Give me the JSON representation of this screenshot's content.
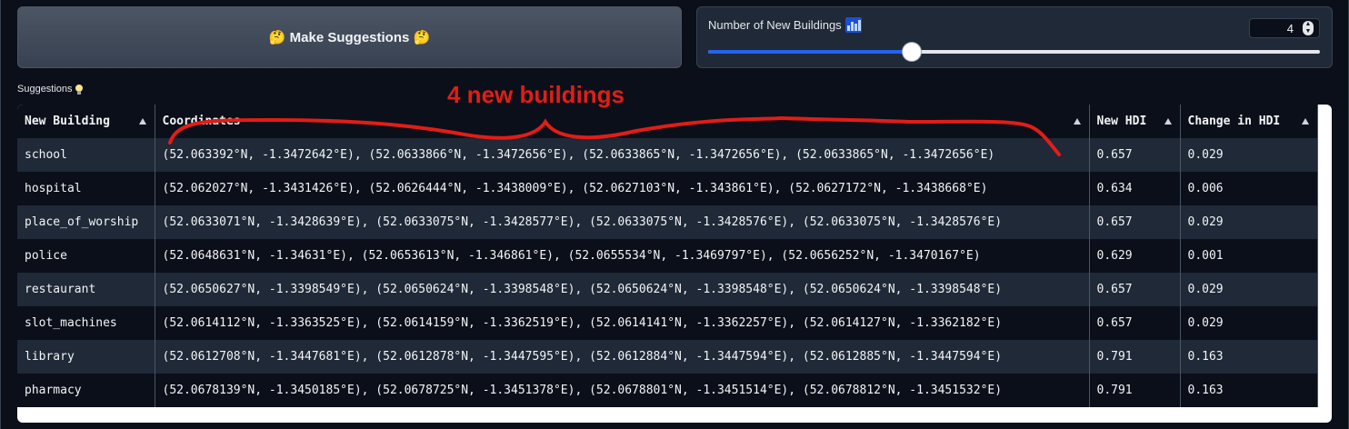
{
  "suggest_button": {
    "label": "🤔 Make Suggestions 🤔"
  },
  "slider": {
    "label": "Number of New Buildings",
    "icon": "bar-chart-icon",
    "value": "4",
    "fill_fraction": 0.333
  },
  "suggestions": {
    "label": "Suggestions",
    "icon": "lightbulb-icon",
    "columns": [
      "New Building",
      "Coordinates",
      "New HDI",
      "Change in HDI"
    ],
    "rows": [
      [
        "school",
        "(52.063392°N, -1.3472642°E), (52.0633866°N, -1.3472656°E), (52.0633865°N, -1.3472656°E), (52.0633865°N, -1.3472656°E)",
        "0.657",
        "0.029"
      ],
      [
        "hospital",
        "(52.062027°N, -1.3431426°E), (52.0626444°N, -1.3438009°E), (52.0627103°N, -1.343861°E), (52.0627172°N, -1.3438668°E)",
        "0.634",
        "0.006"
      ],
      [
        "place_of_worship",
        "(52.0633071°N, -1.3428639°E), (52.0633075°N, -1.3428577°E), (52.0633075°N, -1.3428576°E), (52.0633075°N, -1.3428576°E)",
        "0.657",
        "0.029"
      ],
      [
        "police",
        "(52.0648631°N, -1.34631°E), (52.0653613°N, -1.346861°E), (52.0655534°N, -1.3469797°E), (52.0656252°N, -1.3470167°E)",
        "0.629",
        "0.001"
      ],
      [
        "restaurant",
        "(52.0650627°N, -1.3398549°E), (52.0650624°N, -1.3398548°E), (52.0650624°N, -1.3398548°E), (52.0650624°N, -1.3398548°E)",
        "0.657",
        "0.029"
      ],
      [
        "slot_machines",
        "(52.0614112°N, -1.3363525°E), (52.0614159°N, -1.3362519°E), (52.0614141°N, -1.3362257°E), (52.0614127°N, -1.3362182°E)",
        "0.657",
        "0.029"
      ],
      [
        "library",
        "(52.0612708°N, -1.3447681°E), (52.0612878°N, -1.3447595°E), (52.0612884°N, -1.3447594°E), (52.0612885°N, -1.3447594°E)",
        "0.791",
        "0.163"
      ],
      [
        "pharmacy",
        "(52.0678139°N, -1.3450185°E), (52.0678725°N, -1.3451378°E), (52.0678801°N, -1.3451514°E), (52.0678812°N, -1.3451532°E)",
        "0.791",
        "0.163"
      ]
    ]
  },
  "annotation": {
    "text": "4 new buildings",
    "color": "#e11d17"
  },
  "colors": {
    "accent": "#2563eb",
    "background": "#0b0f19",
    "panel": "#1f2937"
  }
}
